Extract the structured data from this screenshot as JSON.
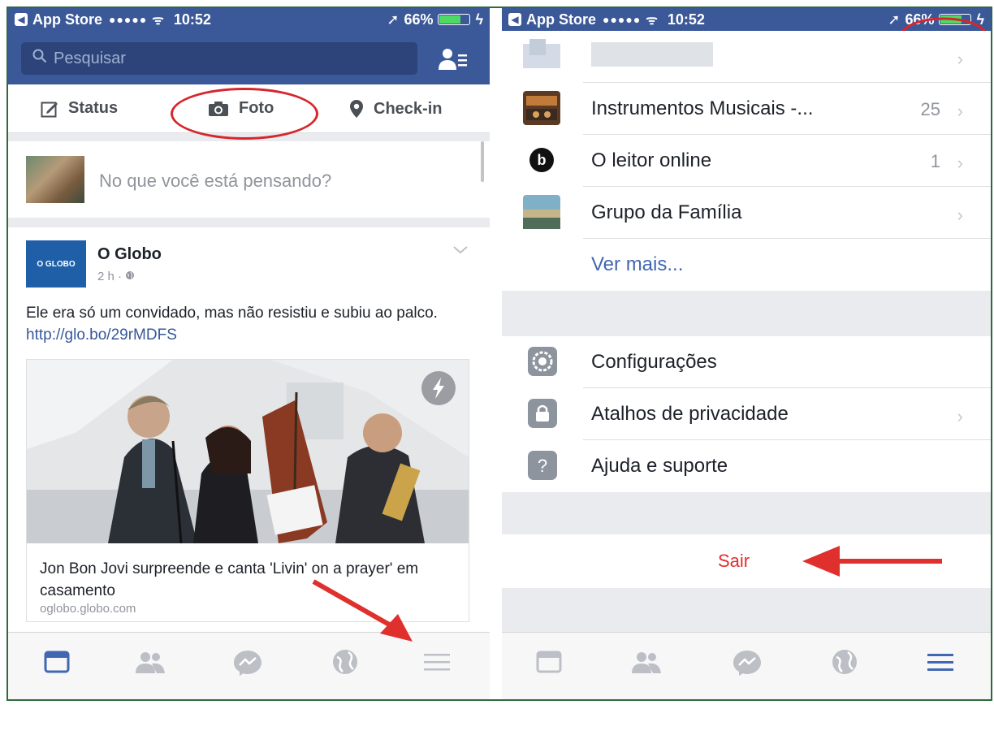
{
  "status_bar": {
    "carrier": "App Store",
    "signal": "●●●●●",
    "wifi": "ᯤ",
    "time": "10:52",
    "battery_percent": "66%",
    "battery_level": 0.66
  },
  "left_screen": {
    "search": {
      "placeholder": "Pesquisar"
    },
    "composer_actions": {
      "status": "Status",
      "foto": "Foto",
      "checkin": "Check-in"
    },
    "composer_prompt": "No que você está pensando?",
    "post": {
      "logo_text": "O GLOBO",
      "author": "O Globo",
      "time": "2 h · ",
      "text": "Ele era só um convidado, mas não resistiu e subiu ao palco. ",
      "link_url": "http://glo.bo/29rMDFS",
      "card_title": "Jon Bon Jovi surpreende e canta 'Livin' on a prayer' em casamento",
      "card_domain": "oglobo.globo.com"
    }
  },
  "right_screen": {
    "menu_items": [
      {
        "label": "Instrumentos Musicais -...",
        "count": "25",
        "chevron": "›"
      },
      {
        "label": "O leitor online",
        "count": "1",
        "chevron": "›"
      },
      {
        "label": "Grupo da Família",
        "count": "",
        "chevron": "›"
      }
    ],
    "ver_mais": "Ver mais...",
    "settings_items": [
      {
        "label": "Configurações",
        "chevron": ""
      },
      {
        "label": "Atalhos de privacidade",
        "chevron": "›"
      },
      {
        "label": "Ajuda e suporte",
        "chevron": ""
      }
    ],
    "logout": "Sair",
    "top_chevron": "›"
  },
  "colors": {
    "facebook_blue": "#3b5998",
    "annotation_red": "#d6262c",
    "logout_red": "#e0302e",
    "active_tab": "#4267b2"
  },
  "icons": {
    "tabs": [
      "news-feed-icon",
      "friends-icon",
      "messenger-icon",
      "notifications-globe-icon",
      "menu-icon"
    ]
  }
}
